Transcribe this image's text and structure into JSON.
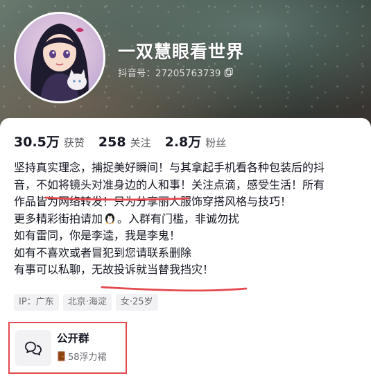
{
  "profile": {
    "nickname": "一双慧眼看世界",
    "douyin_id": "抖音号：27205763739"
  },
  "stats": [
    {
      "value": "30.5万",
      "label": "获赞"
    },
    {
      "value": "258",
      "label": "关注"
    },
    {
      "value": "2.8万",
      "label": "粉丝"
    }
  ],
  "bio": {
    "line1": "坚持真实理念，捕捉美好瞬间！与其拿起手机看各种包装后的抖",
    "line2": "音，不如将镜头对准身边的人和事！关注点滴，感受生活！所有",
    "line3": "作品皆为网络转发！只为分享丽人服饰穿搭风格与技巧！",
    "line4_a": "更多精彩街拍请加",
    "line4_b": "。入群有门槛，非诚勿扰",
    "line5": "如有雷同，你是李逵，我是李鬼！",
    "line6": "如有不喜欢或者冒犯到您请联系删除",
    "line7": "有事可以私聊，无故投诉就当替我挡灾！"
  },
  "tags": [
    "IP：广东",
    "北京·海淀",
    "女·25岁"
  ],
  "group": {
    "title": "公开群",
    "subtitle": "58浮力裙"
  },
  "colors": {
    "annotation_red": "#e5484d",
    "text": "#161823",
    "secondary": "#6b6c72"
  }
}
